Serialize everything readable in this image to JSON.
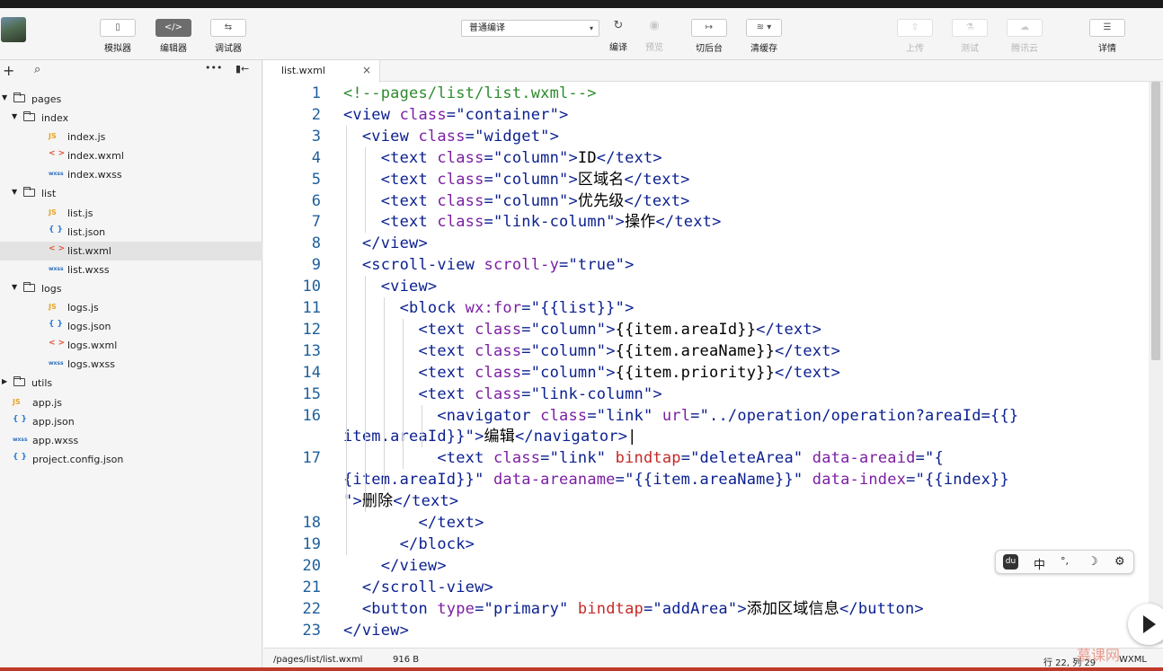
{
  "toolbar": {
    "simulator": "模拟器",
    "editor": "编辑器",
    "debugger": "调试器",
    "compile_mode": "普通编译",
    "compile": "编译",
    "preview": "预览",
    "switch_background": "切后台",
    "clear_cache": "清缓存",
    "upload": "上传",
    "test": "测试",
    "tencent_cloud": "腾讯云",
    "details": "详情"
  },
  "tree": [
    {
      "name": "pages",
      "type": "folder",
      "depth": 0
    },
    {
      "name": "index",
      "type": "folder",
      "depth": 1
    },
    {
      "name": "index.js",
      "type": "js",
      "depth": 2
    },
    {
      "name": "index.wxml",
      "type": "wxml",
      "depth": 2
    },
    {
      "name": "index.wxss",
      "type": "wxss",
      "depth": 2
    },
    {
      "name": "list",
      "type": "folder",
      "depth": 1
    },
    {
      "name": "list.js",
      "type": "js",
      "depth": 2
    },
    {
      "name": "list.json",
      "type": "json",
      "depth": 2
    },
    {
      "name": "list.wxml",
      "type": "wxml",
      "depth": 2,
      "selected": true
    },
    {
      "name": "list.wxss",
      "type": "wxss",
      "depth": 2
    },
    {
      "name": "logs",
      "type": "folder",
      "depth": 1
    },
    {
      "name": "logs.js",
      "type": "js",
      "depth": 2
    },
    {
      "name": "logs.json",
      "type": "json",
      "depth": 2
    },
    {
      "name": "logs.wxml",
      "type": "wxml",
      "depth": 2
    },
    {
      "name": "logs.wxss",
      "type": "wxss",
      "depth": 2
    },
    {
      "name": "utils",
      "type": "folder-collapsed",
      "depth": 0
    },
    {
      "name": "app.js",
      "type": "js",
      "depth": 0
    },
    {
      "name": "app.json",
      "type": "json",
      "depth": 0
    },
    {
      "name": "app.wxss",
      "type": "wxss",
      "depth": 0
    },
    {
      "name": "project.config.json",
      "type": "json",
      "depth": 0
    }
  ],
  "icons": {
    "js": "JS",
    "json": "{ }",
    "wxml": "< >",
    "wxss": "wxss"
  },
  "tab": {
    "name": "list.wxml",
    "close": "×"
  },
  "code": [
    {
      "n": "1",
      "tokens": [
        [
          "com",
          "<!--pages/list/list.wxml-->"
        ]
      ]
    },
    {
      "n": "2",
      "tokens": [
        [
          "tag",
          "<view "
        ],
        [
          "att",
          "class"
        ],
        [
          "tag",
          "="
        ],
        [
          "str",
          "\"container\""
        ],
        [
          "tag",
          ">"
        ]
      ]
    },
    {
      "n": "3",
      "tokens": [
        [
          "txt",
          "  "
        ],
        [
          "tag",
          "<view "
        ],
        [
          "att",
          "class"
        ],
        [
          "tag",
          "="
        ],
        [
          "str",
          "\"widget\""
        ],
        [
          "tag",
          ">"
        ]
      ]
    },
    {
      "n": "4",
      "tokens": [
        [
          "txt",
          "    "
        ],
        [
          "tag",
          "<text "
        ],
        [
          "att",
          "class"
        ],
        [
          "tag",
          "="
        ],
        [
          "str",
          "\"column\""
        ],
        [
          "tag",
          ">"
        ],
        [
          "txt",
          "ID"
        ],
        [
          "tag",
          "</text>"
        ]
      ]
    },
    {
      "n": "5",
      "tokens": [
        [
          "txt",
          "    "
        ],
        [
          "tag",
          "<text "
        ],
        [
          "att",
          "class"
        ],
        [
          "tag",
          "="
        ],
        [
          "str",
          "\"column\""
        ],
        [
          "tag",
          ">"
        ],
        [
          "txt",
          "区域名"
        ],
        [
          "tag",
          "</text>"
        ]
      ]
    },
    {
      "n": "6",
      "tokens": [
        [
          "txt",
          "    "
        ],
        [
          "tag",
          "<text "
        ],
        [
          "att",
          "class"
        ],
        [
          "tag",
          "="
        ],
        [
          "str",
          "\"column\""
        ],
        [
          "tag",
          ">"
        ],
        [
          "txt",
          "优先级"
        ],
        [
          "tag",
          "</text>"
        ]
      ]
    },
    {
      "n": "7",
      "tokens": [
        [
          "txt",
          "    "
        ],
        [
          "tag",
          "<text "
        ],
        [
          "att",
          "class"
        ],
        [
          "tag",
          "="
        ],
        [
          "str",
          "\"link-column\""
        ],
        [
          "tag",
          ">"
        ],
        [
          "txt",
          "操作"
        ],
        [
          "tag",
          "</text>"
        ]
      ]
    },
    {
      "n": "8",
      "tokens": [
        [
          "txt",
          "  "
        ],
        [
          "tag",
          "</view>"
        ]
      ]
    },
    {
      "n": "9",
      "tokens": [
        [
          "txt",
          "  "
        ],
        [
          "tag",
          "<scroll-view "
        ],
        [
          "att",
          "scroll-y"
        ],
        [
          "tag",
          "="
        ],
        [
          "str",
          "\"true\""
        ],
        [
          "tag",
          ">"
        ]
      ]
    },
    {
      "n": "10",
      "tokens": [
        [
          "txt",
          "    "
        ],
        [
          "tag",
          "<view>"
        ]
      ]
    },
    {
      "n": "11",
      "tokens": [
        [
          "txt",
          "      "
        ],
        [
          "tag",
          "<block "
        ],
        [
          "att",
          "wx:for"
        ],
        [
          "tag",
          "="
        ],
        [
          "str",
          "\"{{list}}\""
        ],
        [
          "tag",
          ">"
        ]
      ]
    },
    {
      "n": "12",
      "tokens": [
        [
          "txt",
          "        "
        ],
        [
          "tag",
          "<text "
        ],
        [
          "att",
          "class"
        ],
        [
          "tag",
          "="
        ],
        [
          "str",
          "\"column\""
        ],
        [
          "tag",
          ">"
        ],
        [
          "txt",
          "{{item.areaId}}"
        ],
        [
          "tag",
          "</text>"
        ]
      ]
    },
    {
      "n": "13",
      "tokens": [
        [
          "txt",
          "        "
        ],
        [
          "tag",
          "<text "
        ],
        [
          "att",
          "class"
        ],
        [
          "tag",
          "="
        ],
        [
          "str",
          "\"column\""
        ],
        [
          "tag",
          ">"
        ],
        [
          "txt",
          "{{item.areaName}}"
        ],
        [
          "tag",
          "</text>"
        ]
      ]
    },
    {
      "n": "14",
      "tokens": [
        [
          "txt",
          "        "
        ],
        [
          "tag",
          "<text "
        ],
        [
          "att",
          "class"
        ],
        [
          "tag",
          "="
        ],
        [
          "str",
          "\"column\""
        ],
        [
          "tag",
          ">"
        ],
        [
          "txt",
          "{{item.priority}}"
        ],
        [
          "tag",
          "</text>"
        ]
      ]
    },
    {
      "n": "15",
      "tokens": [
        [
          "txt",
          "        "
        ],
        [
          "tag",
          "<text "
        ],
        [
          "att",
          "class"
        ],
        [
          "tag",
          "="
        ],
        [
          "str",
          "\"link-column\""
        ],
        [
          "tag",
          ">"
        ]
      ]
    },
    {
      "n": "16",
      "tokens": [
        [
          "txt",
          "          "
        ],
        [
          "tag",
          "<navigator "
        ],
        [
          "att",
          "class"
        ],
        [
          "tag",
          "="
        ],
        [
          "str",
          "\"link\" "
        ],
        [
          "att",
          "url"
        ],
        [
          "tag",
          "="
        ],
        [
          "str",
          "\"../operation/operation?areaId={{}"
        ]
      ]
    },
    {
      "n": "",
      "tokens": [
        [
          "str",
          "item.areaId}}\""
        ],
        [
          "tag",
          ">"
        ],
        [
          "txt",
          "编辑"
        ],
        [
          "tag",
          "</navigator>"
        ],
        [
          "txt",
          "|"
        ]
      ]
    },
    {
      "n": "17",
      "tokens": [
        [
          "txt",
          "          "
        ],
        [
          "tag",
          "<text "
        ],
        [
          "att",
          "class"
        ],
        [
          "tag",
          "="
        ],
        [
          "str",
          "\"link\" "
        ],
        [
          "red",
          "bindtap"
        ],
        [
          "tag",
          "="
        ],
        [
          "str",
          "\"deleteArea\" "
        ],
        [
          "att",
          "data-areaid"
        ],
        [
          "tag",
          "="
        ],
        [
          "str",
          "\"{"
        ]
      ]
    },
    {
      "n": "",
      "tokens": [
        [
          "str",
          "{item.areaId}}\" "
        ],
        [
          "att",
          "data-areaname"
        ],
        [
          "tag",
          "="
        ],
        [
          "str",
          "\"{{item.areaName}}\" "
        ],
        [
          "att",
          "data-index"
        ],
        [
          "tag",
          "="
        ],
        [
          "str",
          "\"{{index}}"
        ]
      ]
    },
    {
      "n": "",
      "tokens": [
        [
          "str",
          "\""
        ],
        [
          "tag",
          ">"
        ],
        [
          "txt",
          "删除"
        ],
        [
          "tag",
          "</text>"
        ]
      ]
    },
    {
      "n": "18",
      "tokens": [
        [
          "txt",
          "        "
        ],
        [
          "tag",
          "</text>"
        ]
      ]
    },
    {
      "n": "19",
      "tokens": [
        [
          "txt",
          "      "
        ],
        [
          "tag",
          "</block>"
        ]
      ]
    },
    {
      "n": "20",
      "tokens": [
        [
          "txt",
          "    "
        ],
        [
          "tag",
          "</view>"
        ]
      ]
    },
    {
      "n": "21",
      "tokens": [
        [
          "txt",
          "  "
        ],
        [
          "tag",
          "</scroll-view>"
        ]
      ]
    },
    {
      "n": "22",
      "tokens": [
        [
          "txt",
          "  "
        ],
        [
          "tag",
          "<button "
        ],
        [
          "att",
          "type"
        ],
        [
          "tag",
          "="
        ],
        [
          "str",
          "\"primary\" "
        ],
        [
          "red",
          "bindtap"
        ],
        [
          "tag",
          "="
        ],
        [
          "str",
          "\"addArea\""
        ],
        [
          "tag",
          ">"
        ],
        [
          "txt",
          "添加区域信息"
        ],
        [
          "tag",
          "</button>"
        ]
      ]
    },
    {
      "n": "23",
      "tokens": [
        [
          "tag",
          "</view>"
        ]
      ]
    }
  ],
  "status": {
    "path": "/pages/list/list.wxml",
    "size": "916 B",
    "position": "行 22, 列 29",
    "language": "WXML"
  },
  "ime": {
    "mode": "中",
    "punct": "°,",
    "moon": "☽",
    "settings": "⚙"
  },
  "watermark": "慕课网"
}
